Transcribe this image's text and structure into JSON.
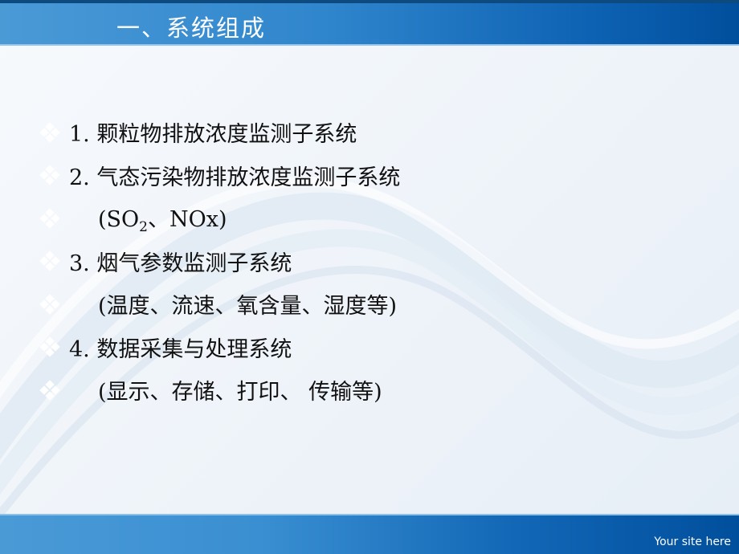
{
  "slide": {
    "title": "一、系统组成",
    "bullet_icon": "four-diamond-bullet-icon",
    "items": [
      {
        "text": "1. 颗粒物排放浓度监测子系统",
        "indent": false
      },
      {
        "text": "2. 气态污染物排放浓度监测子系统",
        "indent": false
      },
      {
        "text_prefix": "(SO",
        "subscript": "2",
        "text_suffix": "、NOx)",
        "indent": true
      },
      {
        "text": "3. 烟气参数监测子系统",
        "indent": false
      },
      {
        "text": "(温度、流速、氧含量、湿度等)",
        "indent": true
      },
      {
        "text": "4. 数据采集与处理系统",
        "indent": false
      },
      {
        "text": "(显示、存储、打印、 传输等)",
        "indent": true
      }
    ],
    "footer": "Your site here"
  },
  "colors": {
    "header_blue": "#2f85cc",
    "header_dark": "#004f9d",
    "text": "#111111",
    "background": "#f2f6fb"
  }
}
